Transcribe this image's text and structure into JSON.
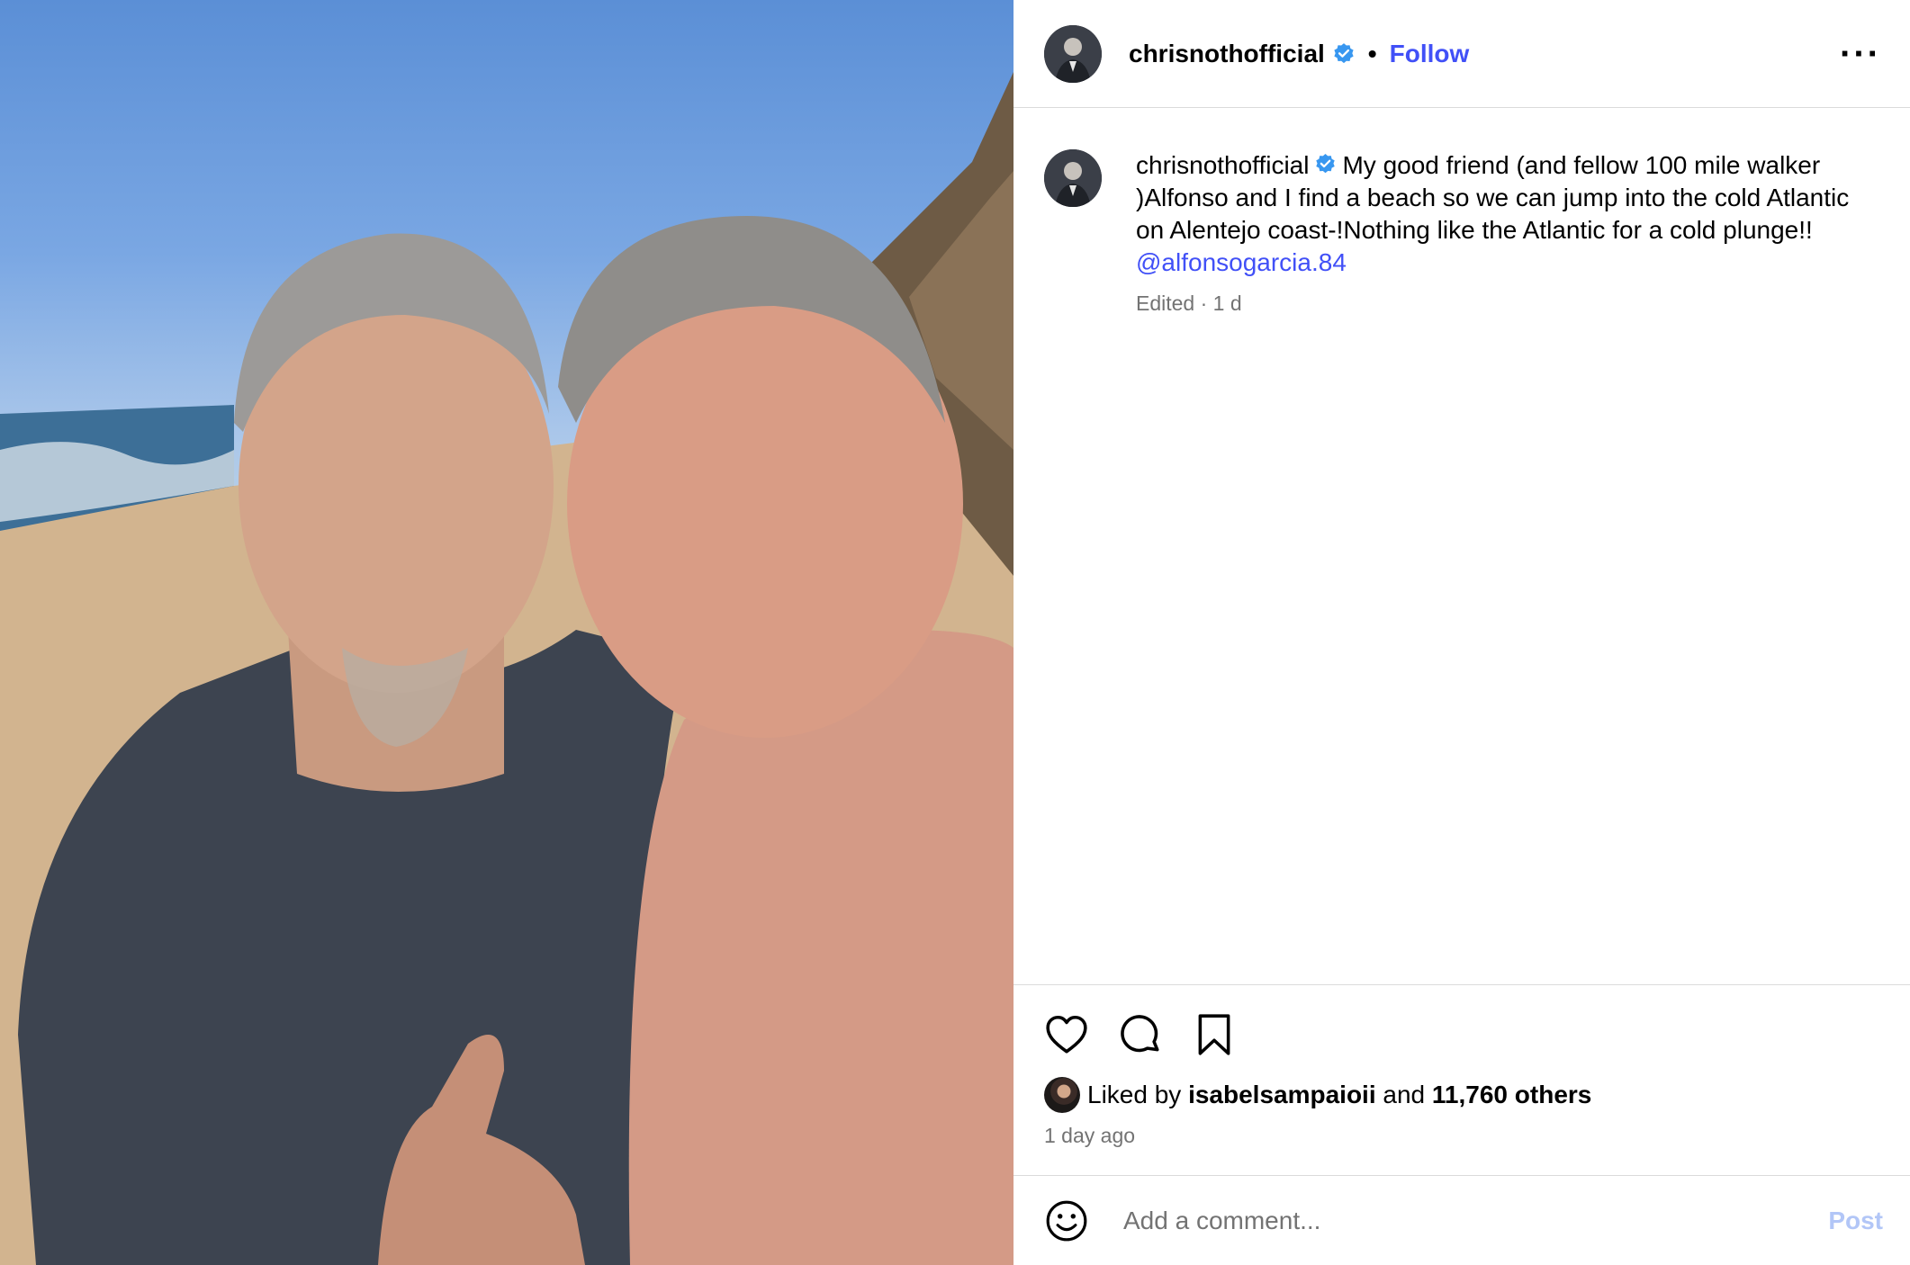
{
  "post": {
    "author": "chrisnothofficial",
    "follow_label": "Follow",
    "separator": "•",
    "more_label": "···"
  },
  "caption": {
    "author": "chrisnothofficial",
    "text": "My good friend (and fellow 100 mile walker )Alfonso and I find a beach so we can jump into the cold Atlantic on Alentejo coast-!Nothing like the Atlantic for a cold plunge!!",
    "mention": "@alfonsogarcia.84",
    "meta": "Edited · 1 d"
  },
  "engagement": {
    "liked_by_prefix": "Liked by",
    "liked_by_user": "isabelsampaioii",
    "and_label": "and",
    "others": "11,760 others",
    "time_ago": "1 day ago"
  },
  "comment_box": {
    "placeholder": "Add a comment...",
    "post_label": "Post"
  },
  "colors": {
    "link": "#4150f7",
    "verified": "#3897f0",
    "muted": "#737373",
    "post_disabled": "#b2c6f7"
  },
  "icons": {
    "like": "heart-icon",
    "comment": "comment-bubble-icon",
    "save": "bookmark-icon",
    "emoji": "smiley-icon",
    "verified": "verified-badge-icon",
    "more": "more-options-icon"
  }
}
